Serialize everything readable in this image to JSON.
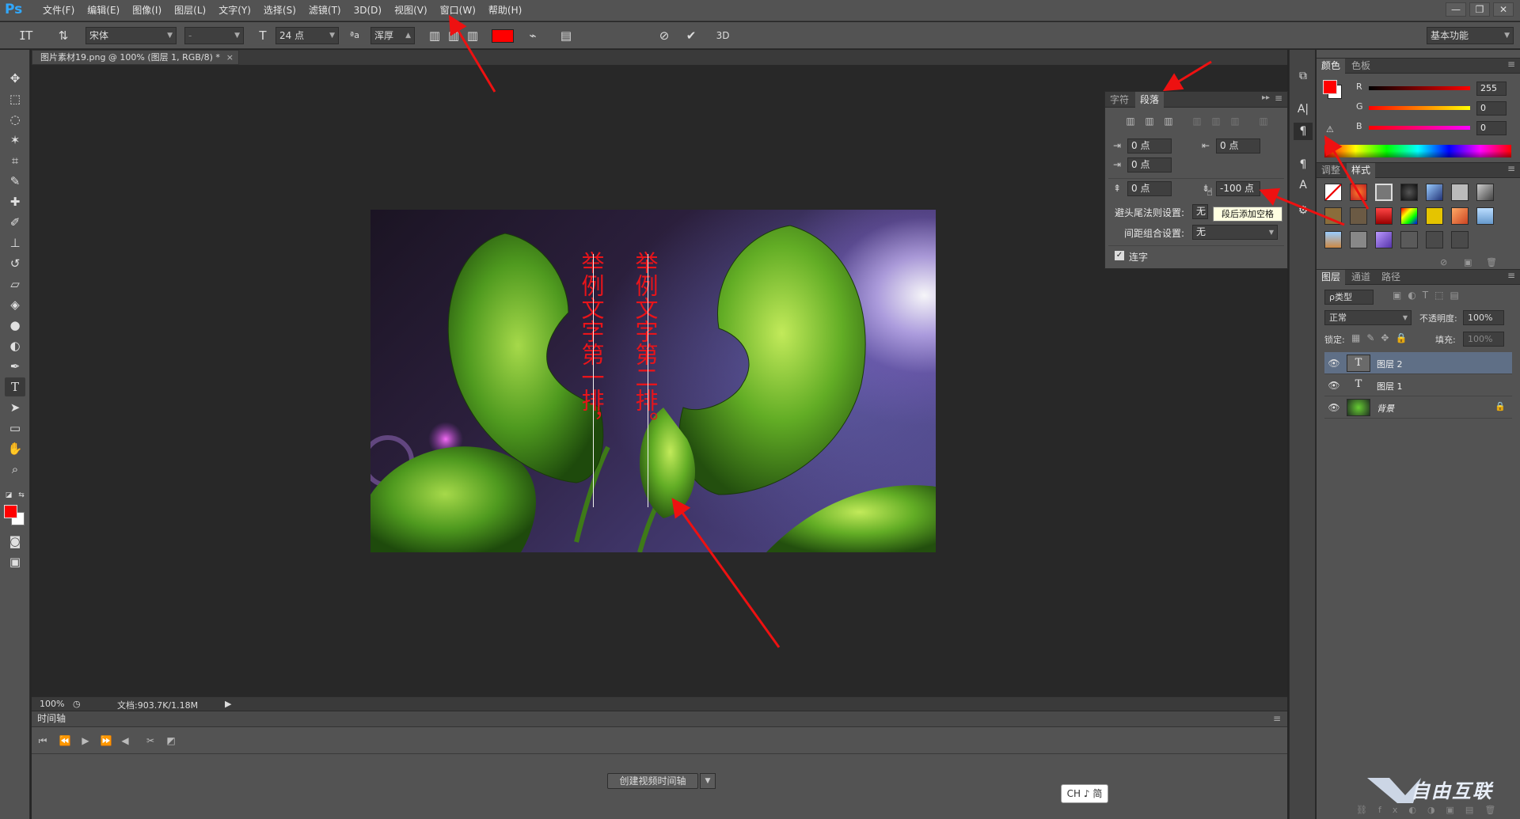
{
  "app": {
    "logo": "Ps"
  },
  "menu": [
    "文件(F)",
    "编辑(E)",
    "图像(I)",
    "图层(L)",
    "文字(Y)",
    "选择(S)",
    "滤镜(T)",
    "3D(D)",
    "视图(V)",
    "窗口(W)",
    "帮助(H)"
  ],
  "window_controls": [
    "—",
    "❐",
    "✕"
  ],
  "options_bar": {
    "font_family": "宋体",
    "font_style": "-",
    "font_size": "24 点",
    "antialias_label": "ªa",
    "antialias": "浑厚",
    "text_color": "#ff0000",
    "workspace": "基本功能"
  },
  "document": {
    "tab_title": "图片素材19.png @ 100% (图层 1, RGB/8) *",
    "vertical_text_1": "举例文字第一排，",
    "vertical_text_2": "举例文字第二排。",
    "zoom": "100%",
    "doc_size": "文档:903.7K/1.18M"
  },
  "timeline": {
    "title": "时间轴",
    "create_button": "创建视频时间轴"
  },
  "ime": "CH ♪ 简",
  "paragraph_panel": {
    "tabs": [
      "字符",
      "段落"
    ],
    "indent_left": "0 点",
    "indent_right": "0 点",
    "indent_first": "0 点",
    "space_before": "0 点",
    "space_after": "-100 点",
    "kinsoku_label": "避头尾法则设置:",
    "kinsoku_value": "无",
    "mojikumi_label": "间距组合设置:",
    "mojikumi_value": "无",
    "hyphenate_label": "连字",
    "tooltip": "段后添加空格"
  },
  "color_panel": {
    "tabs": [
      "颜色",
      "色板"
    ],
    "r_label": "R",
    "g_label": "G",
    "b_label": "B",
    "r": "255",
    "g": "0",
    "b": "0",
    "foreground": "#ff0000"
  },
  "styles_panel": {
    "tabs": [
      "调整",
      "样式"
    ]
  },
  "layers_panel": {
    "tabs": [
      "图层",
      "通道",
      "路径"
    ],
    "filter": "ρ类型",
    "blend_mode": "正常",
    "opacity_label": "不透明度:",
    "opacity": "100%",
    "lock_label": "锁定:",
    "fill_label": "填充:",
    "fill": "100%",
    "layers": [
      {
        "name": "图层 2",
        "type": "T"
      },
      {
        "name": "图层 1",
        "type": "T"
      },
      {
        "name": "背景",
        "type": "image"
      }
    ]
  },
  "watermark": "自由互联"
}
